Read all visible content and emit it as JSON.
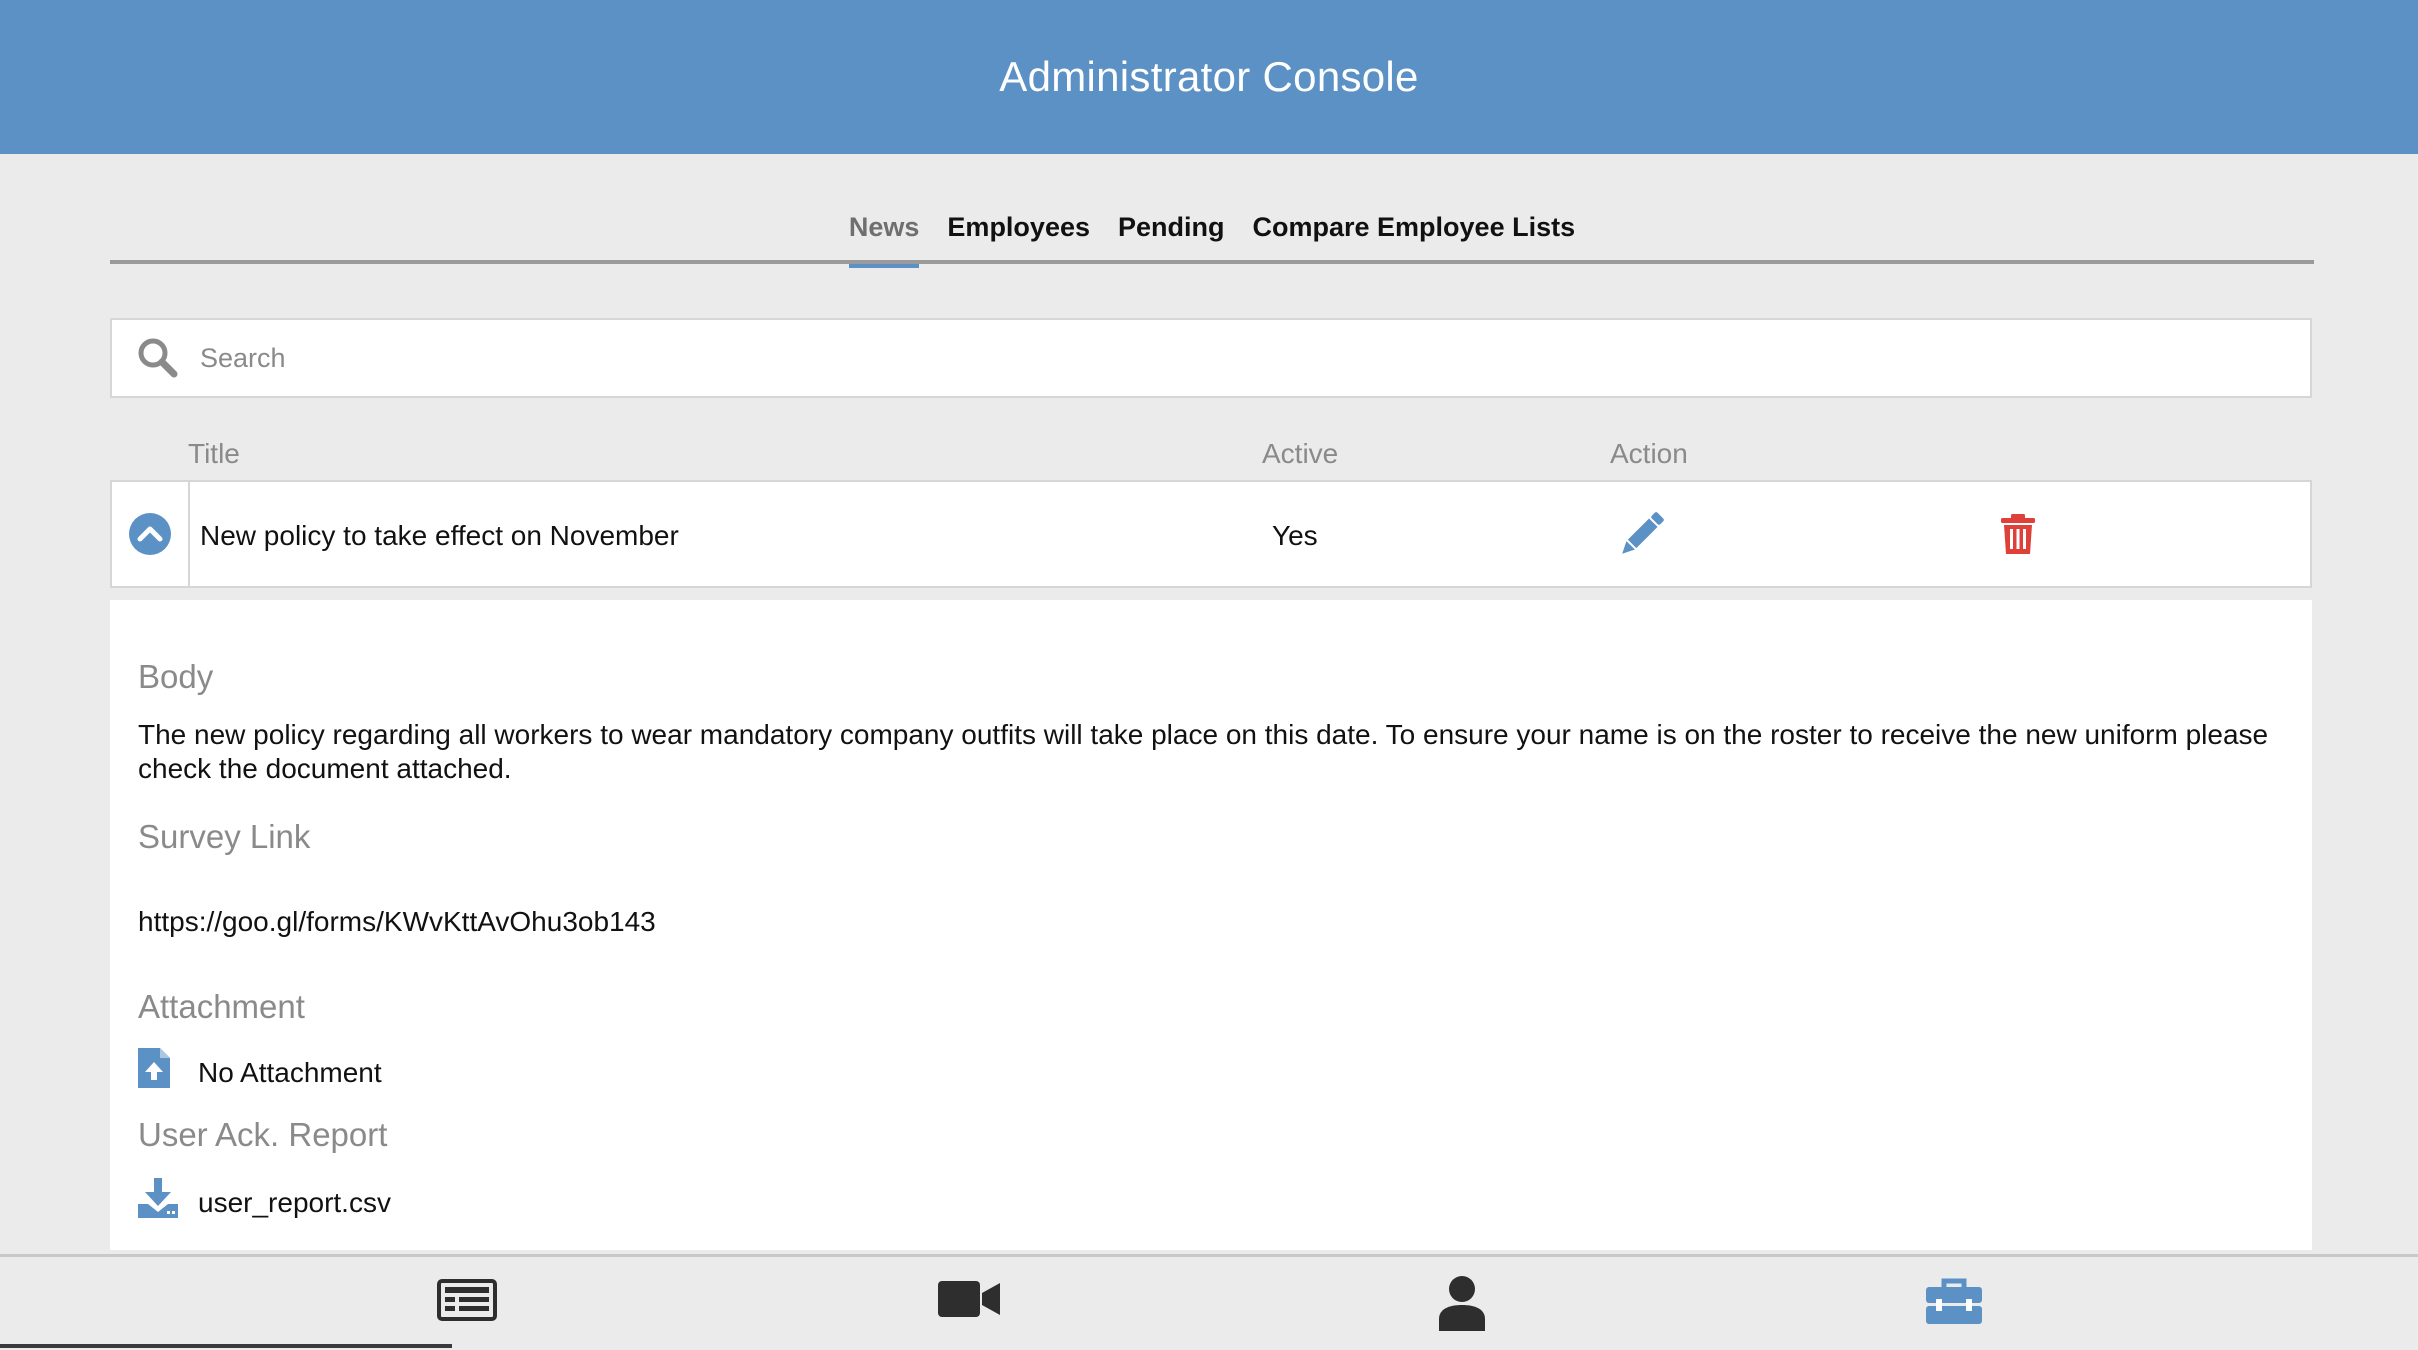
{
  "header": {
    "title": "Administrator Console"
  },
  "tabs": [
    {
      "label": "News",
      "active": true
    },
    {
      "label": "Employees",
      "active": false
    },
    {
      "label": "Pending",
      "active": false
    },
    {
      "label": "Compare Employee Lists",
      "active": false
    }
  ],
  "search": {
    "placeholder": "Search",
    "value": ""
  },
  "table": {
    "columns": [
      "Title",
      "Active",
      "Action"
    ],
    "rows": [
      {
        "title": "New policy to take effect  on November",
        "active": "Yes"
      }
    ]
  },
  "detail": {
    "body_label": "Body",
    "body_text": "The new policy regarding all workers to wear mandatory company outfits will take place on this date. To ensure your name is on the roster to receive the new uniform please check the document attached.",
    "survey_label": "Survey Link",
    "survey_url": "https://goo.gl/forms/KWvKttAvOhu3ob143",
    "attachment_label": "Attachment",
    "attachment_value": "No Attachment",
    "report_label": "User Ack. Report",
    "report_file": "user_report.csv"
  },
  "bottom_nav": [
    {
      "icon": "news-icon",
      "active": false
    },
    {
      "icon": "video-camera-icon",
      "active": false
    },
    {
      "icon": "user-icon",
      "active": false
    },
    {
      "icon": "toolbox-icon",
      "active": true
    }
  ],
  "colors": {
    "header": "#5b91c4",
    "accent": "#5b91c4",
    "delete": "#e0403a",
    "background": "#ebebeb",
    "muted_text": "#8a8a8a"
  }
}
